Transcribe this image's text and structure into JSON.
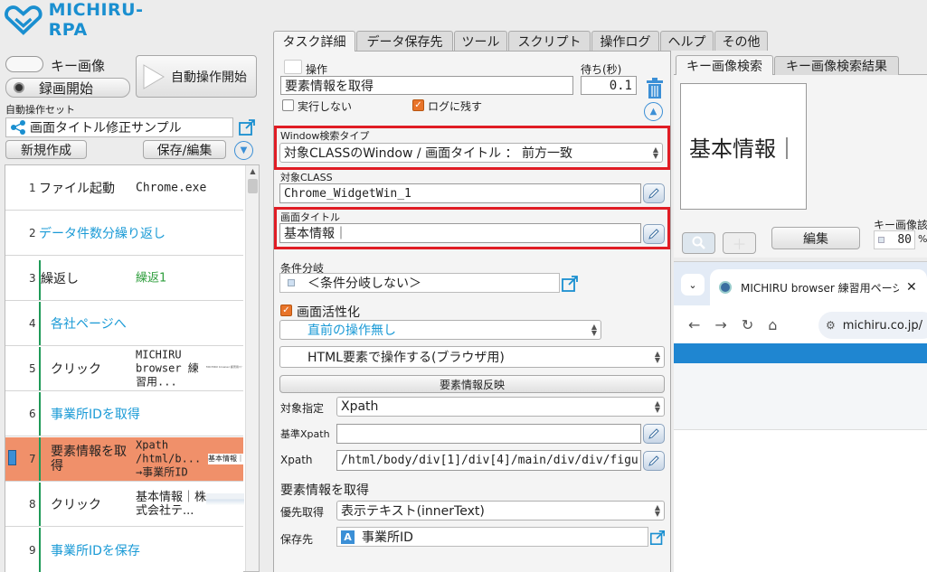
{
  "app": {
    "logo_text": "MICHIRU-RPA"
  },
  "left": {
    "toggle_label": "キー画像",
    "record_label": "録画開始",
    "auto_start_label": "自動操作開始",
    "preset_label": "自動操作セット",
    "preset_value": "画面タイトル修正サンプル",
    "new_button": "新規作成",
    "save_button": "保存/編集"
  },
  "steps": [
    {
      "num": "1",
      "action": "ファイル起動",
      "detail": "Chrome.exe"
    },
    {
      "num": "2",
      "action": "データ件数分繰り返し",
      "detail": ""
    },
    {
      "num": "3",
      "action": "繰返し",
      "detail": "繰返1"
    },
    {
      "num": "4",
      "action": "各社ページへ",
      "detail": ""
    },
    {
      "num": "5",
      "action": "クリック",
      "detail": "MICHIRU browser 練習用...",
      "thumb": "MICHIRU browser 練習用ページ"
    },
    {
      "num": "6",
      "action": "事業所IDを取得",
      "detail": ""
    },
    {
      "num": "7",
      "action": "要素情報を取得",
      "detail": "Xpath /html/b... →事業所ID",
      "thumb": "基本情報｜"
    },
    {
      "num": "8",
      "action": "クリック",
      "detail": "基本情報｜株式会社テ...",
      "thumb": ""
    },
    {
      "num": "9",
      "action": "事業所IDを保存",
      "detail": ""
    }
  ],
  "tabs": [
    "タスク詳細",
    "データ保存先",
    "ツール",
    "スクリプト",
    "操作ログ",
    "ヘルプ",
    "その他"
  ],
  "task": {
    "op_label": "操作",
    "wait_label": "待ち(秒)",
    "op_value": "要素情報を取得",
    "wait_value": "0.1",
    "no_exec_label": "実行しない",
    "log_label": "ログに残す",
    "window_search_label": "Window検索タイプ",
    "window_search_value": "対象CLASSのWindow / 画面タイトル ： 前方一致",
    "class_label": "対象CLASS",
    "class_value": "Chrome_WidgetWin_1",
    "title_label": "画面タイトル",
    "title_value": "基本情報｜",
    "branch_label": "条件分岐",
    "branch_value": "＜条件分岐しない＞",
    "activate_label": "画面活性化",
    "prev_op_value": "直前の操作無し",
    "html_op_value": "HTML要素で操作する(ブラウザ用)",
    "reflect_button": "要素情報反映",
    "target_spec_label": "対象指定",
    "target_spec_value": "Xpath",
    "base_xpath_label": "基準Xpath",
    "base_xpath_value": "",
    "xpath_label": "Xpath",
    "xpath_value": "/html/body/div[1]/div[4]/main/div/div/figu",
    "get_info_label": "要素情報を取得",
    "priority_label": "優先取得",
    "priority_value": "表示テキスト(innerText)",
    "save_to_label": "保存先",
    "save_to_value": "事業所ID",
    "save_to_badge": "A"
  },
  "right": {
    "tab_key_image": "キー画像検索",
    "tab_key_result": "キー画像検索結果",
    "preview_text": "基本情報｜",
    "edit_button": "編集",
    "key_image_label": "キー画像該",
    "percent_value": "80",
    "percent_unit": "%"
  },
  "browser": {
    "tab_title": "MICHIRU browser 練習用ページ",
    "url": "michiru.co.jp/"
  },
  "colors": {
    "highlight_row": "#f0906a",
    "accent_blue": "#1a9ad6",
    "red_box": "#e01c24",
    "browser_bar": "#1f86d1"
  }
}
